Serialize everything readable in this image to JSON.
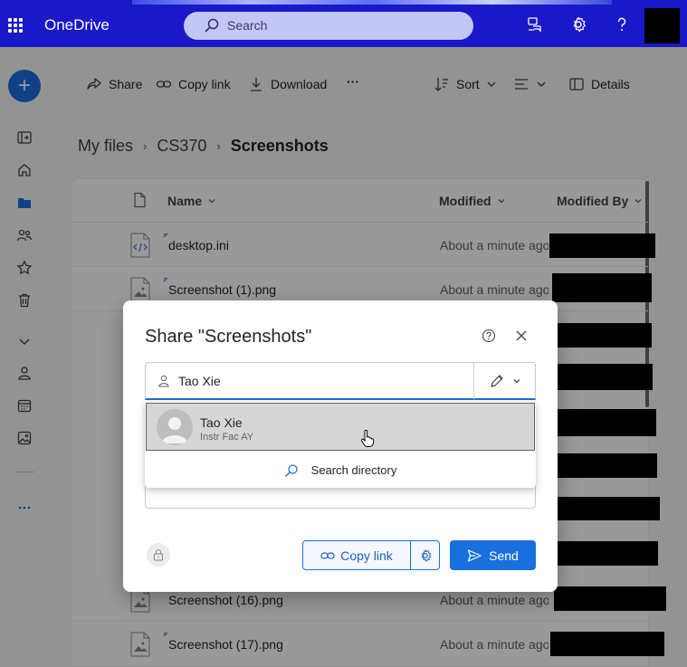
{
  "header": {
    "app_name": "OneDrive",
    "search_placeholder": "Search",
    "icons": [
      "app-launcher-icon",
      "feedback-icon",
      "settings-icon",
      "help-icon"
    ]
  },
  "rail": {
    "new_label": "+",
    "icons": [
      "collapse-icon",
      "home-icon",
      "my-files-icon",
      "shared-icon",
      "favorites-icon",
      "recycle-bin-icon",
      "expand-icon",
      "people-icon",
      "meetings-icon",
      "photos-icon",
      "more-icon"
    ]
  },
  "commands": {
    "share": "Share",
    "copy_link": "Copy link",
    "download": "Download",
    "more": "···",
    "sort": "Sort",
    "details": "Details"
  },
  "breadcrumb": {
    "items": [
      "My files",
      "CS370",
      "Screenshots"
    ],
    "separator": "›"
  },
  "file_list": {
    "columns": {
      "name": "Name",
      "modified": "Modified",
      "modified_by": "Modified By"
    },
    "rows": [
      {
        "name": "desktop.ini",
        "modified": "About a minute ago",
        "type": "code"
      },
      {
        "name": "Screenshot (1).png",
        "modified": "About a minute ago",
        "type": "image"
      },
      {
        "name": "Screenshot (16).png",
        "modified": "About a minute ago",
        "type": "image"
      },
      {
        "name": "Screenshot (17).png",
        "modified": "About a minute ago",
        "type": "image"
      }
    ]
  },
  "share_dialog": {
    "title": "Share \"Screenshots\"",
    "recipient_value": "Tao Xie",
    "copy_link_label": "Copy link",
    "send_label": "Send"
  },
  "suggestions": {
    "person": {
      "name": "Tao Xie",
      "subtitle": "Instr Fac AY"
    },
    "search_directory_label": "Search directory"
  },
  "colors": {
    "header_bg": "#1a19c9",
    "accent": "#1a6fde"
  }
}
